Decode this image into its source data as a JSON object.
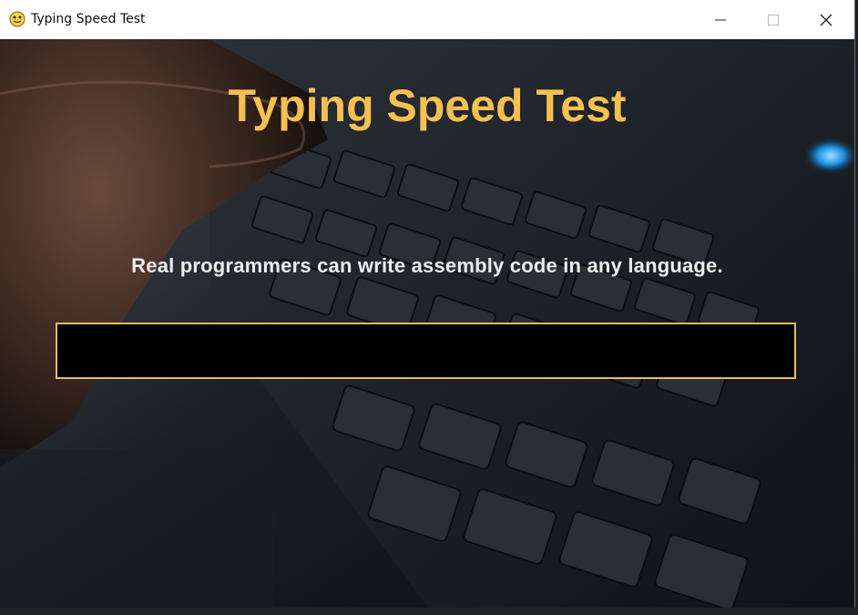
{
  "window": {
    "title": "Typing Speed Test",
    "app_icon": "python-icon",
    "controls": {
      "minimize_icon": "minimize-icon",
      "maximize_icon": "maximize-icon",
      "close_icon": "close-icon"
    }
  },
  "game": {
    "heading": "Typing Speed Test",
    "sentence": "Real programmers can write assembly code in any language.",
    "input": {
      "value": "",
      "placeholder": ""
    },
    "background": "laptop-keyboard-photo"
  },
  "colors": {
    "heading": "#f5c052",
    "sentence": "#eeeeee",
    "input_border": "#e7bd5c",
    "input_background": "#000000"
  }
}
